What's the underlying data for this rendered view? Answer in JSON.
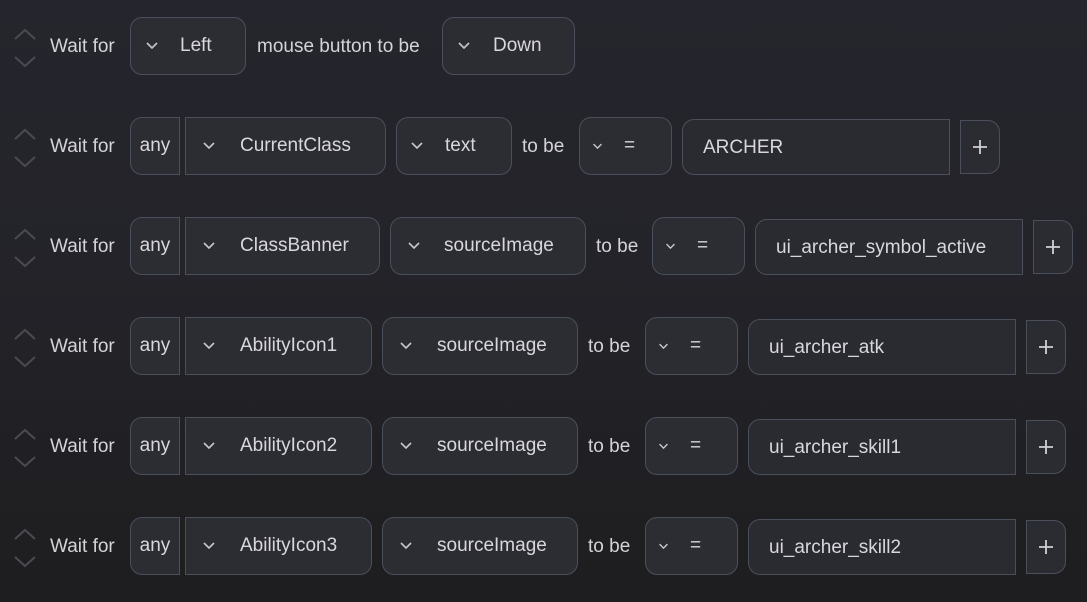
{
  "rows": [
    {
      "prefix": "Wait for",
      "button_select": "Left",
      "middle_label": "mouse button to be",
      "state_select": "Down"
    },
    {
      "prefix": "Wait for",
      "quantifier": "any",
      "object": "CurrentClass",
      "property": "text",
      "to_be": "to be",
      "operator": "=",
      "value": "ARCHER"
    },
    {
      "prefix": "Wait for",
      "quantifier": "any",
      "object": "ClassBanner",
      "property": "sourceImage",
      "to_be": "to be",
      "operator": "=",
      "value": "ui_archer_symbol_active"
    },
    {
      "prefix": "Wait for",
      "quantifier": "any",
      "object": "AbilityIcon1",
      "property": "sourceImage",
      "to_be": "to be",
      "operator": "=",
      "value": "ui_archer_atk"
    },
    {
      "prefix": "Wait for",
      "quantifier": "any",
      "object": "AbilityIcon2",
      "property": "sourceImage",
      "to_be": "to be",
      "operator": "=",
      "value": "ui_archer_skill1"
    },
    {
      "prefix": "Wait for",
      "quantifier": "any",
      "object": "AbilityIcon3",
      "property": "sourceImage",
      "to_be": "to be",
      "operator": "=",
      "value": "ui_archer_skill2"
    }
  ],
  "icons": {
    "move_up": "chevron-up-icon",
    "move_down": "chevron-down-icon",
    "dropdown": "chevron-down-icon",
    "add": "plus-icon"
  },
  "colors": {
    "background": "#232329",
    "control_bg": "#2c2c33",
    "control_border": "#4a4f5c",
    "text": "#d6d6da",
    "reorder_icon": "#4a4a50"
  }
}
